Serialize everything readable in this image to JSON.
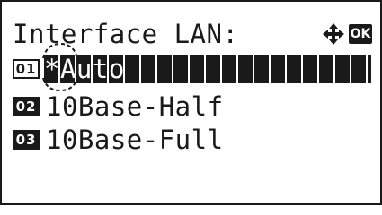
{
  "screen": {
    "title": "Interface LAN:",
    "nav_icon": "four-way-arrows-icon",
    "ok_label": "OK"
  },
  "menu": {
    "items": [
      {
        "number": "01",
        "label": "*Auto",
        "selected": true
      },
      {
        "number": "02",
        "label": "10Base-Half",
        "selected": false
      },
      {
        "number": "03",
        "label": "10Base-Full",
        "selected": false
      }
    ]
  },
  "colors": {
    "foreground": "#1a1a1a",
    "background": "#ffffff",
    "selection": "#1a1a1a"
  }
}
